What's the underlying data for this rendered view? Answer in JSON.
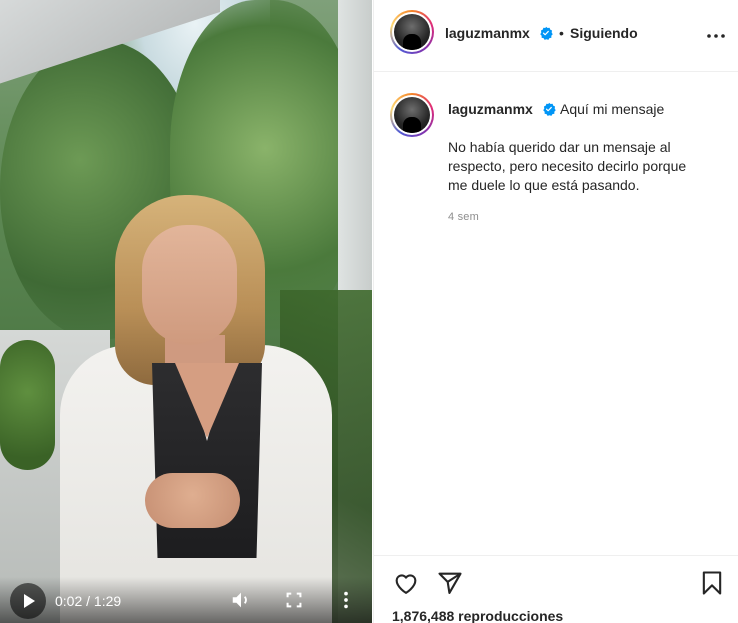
{
  "video": {
    "current_time": "0:02",
    "duration": "1:29",
    "time_separator": " / ",
    "icons": {
      "play": "play-icon",
      "volume": "volume-icon",
      "fullscreen": "fullscreen-icon",
      "menu": "vertical-dots-icon"
    }
  },
  "header": {
    "username": "laguzmanmx",
    "separator": "•",
    "follow_state": "Siguiendo",
    "icons": {
      "verified": "verified-badge-icon",
      "more": "more-options-icon"
    }
  },
  "caption": {
    "username": "laguzmanmx",
    "title": "Aquí mi mensaje",
    "body": "No había querido dar un mensaje al\nrespecto, pero necesito decirlo porque\nme duele lo que está pasando.",
    "time_ago": "4 sem"
  },
  "actions": {
    "icons": {
      "like": "heart-icon",
      "share": "send-icon",
      "save": "bookmark-icon"
    },
    "views_label": "1,876,488 reproducciones"
  },
  "colors": {
    "text": "#262626",
    "muted": "#8e8e8e",
    "verified": "#0095f6",
    "border": "#efefef"
  }
}
